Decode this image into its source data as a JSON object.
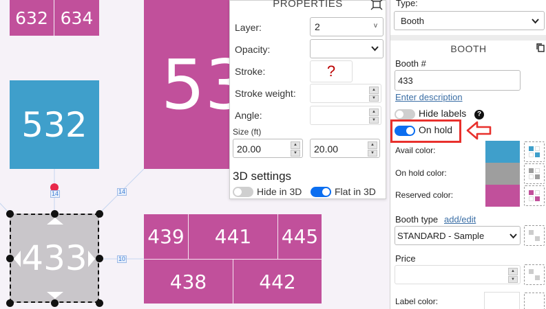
{
  "canvas": {
    "booths": {
      "b632": "632",
      "b634": "634",
      "b53x": "53",
      "b532": "532",
      "b433": "433",
      "b439": "439",
      "b441": "441",
      "b445": "445",
      "b438": "438",
      "b442": "442"
    },
    "dim_labels": {
      "d1": "14",
      "d2": "14",
      "d3": "10"
    }
  },
  "properties": {
    "title": "PROPERTIES",
    "layer_label": "Layer:",
    "layer_value": "2",
    "opacity_label": "Opacity:",
    "opacity_value": "",
    "stroke_label": "Stroke:",
    "stroke_value": "?",
    "stroke_weight_label": "Stroke weight:",
    "angle_label": "Angle:",
    "size_label": "Size (ft)",
    "size_w": "20.00",
    "size_h": "20.00",
    "settings3d_title": "3D settings",
    "hide3d_label": "Hide in 3D",
    "flat3d_label": "Flat in 3D"
  },
  "right": {
    "type_label": "Type:",
    "type_value": "Booth",
    "section_title": "BOOTH",
    "booth_num_label": "Booth #",
    "booth_num_value": "433",
    "enter_description": "Enter description",
    "hide_labels": "Hide labels",
    "help_glyph": "?",
    "on_hold": "On hold",
    "avail_color_label": "Avail color:",
    "onhold_color_label": "On hold color:",
    "reserved_color_label": "Reserved color:",
    "booth_type_label": "Booth type",
    "add_edit": "add/edit",
    "booth_type_value": "STANDARD - Sample",
    "price_label": "Price",
    "price_value": "",
    "label_color_label": "Label color:"
  },
  "colors": {
    "avail": "#3f9fcb",
    "onhold": "#9e9e9e",
    "reserved": "#c1509b",
    "booth_pink": "#c1509b",
    "booth_blue": "#3f9fcb",
    "highlight": "#e8302c",
    "toggle_on": "#0b6ef0"
  }
}
